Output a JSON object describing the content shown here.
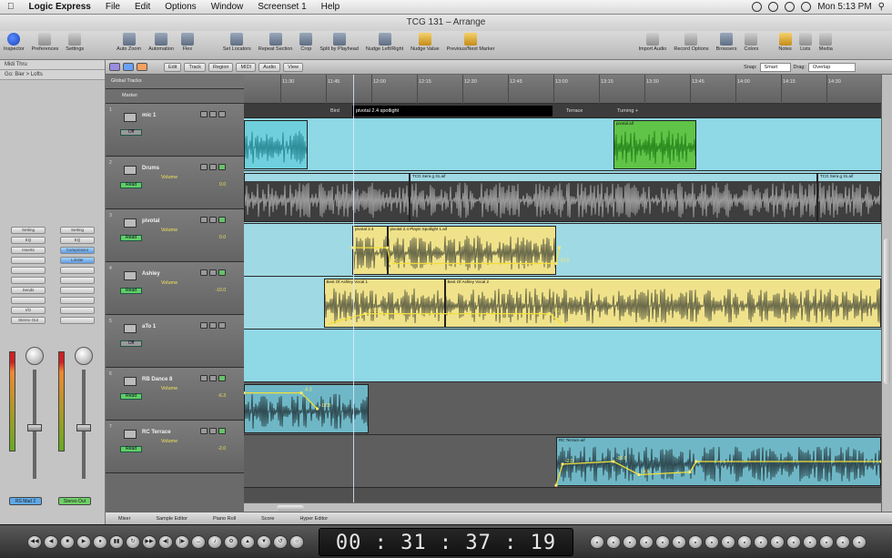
{
  "menubar": {
    "app": "Logic Express",
    "items": [
      "File",
      "Edit",
      "Options",
      "Window",
      "Screenset 1",
      "Help"
    ],
    "clock": "Mon 5:13 PM"
  },
  "window": {
    "title": "TCG 131 – Arrange"
  },
  "toolbar": {
    "items": [
      {
        "label": "Inspector",
        "icon": "info-icon",
        "style": "b"
      },
      {
        "label": "Preferences",
        "icon": "preferences-icon",
        "style": "g"
      },
      {
        "label": "Settings",
        "icon": "settings-icon",
        "style": "g"
      },
      {
        "label": "Auto Zoom",
        "icon": "zoom-icon",
        "style": ""
      },
      {
        "label": "Automation",
        "icon": "automation-icon",
        "style": ""
      },
      {
        "label": "Flex",
        "icon": "flex-icon",
        "style": ""
      },
      {
        "label": "Set Locators",
        "icon": "locators-icon",
        "style": ""
      },
      {
        "label": "Repeat Section",
        "icon": "repeat-icon",
        "style": ""
      },
      {
        "label": "Crop",
        "icon": "crop-icon",
        "style": ""
      },
      {
        "label": "Split by Playhead",
        "icon": "split-icon",
        "style": ""
      },
      {
        "label": "Nudge Left/Right",
        "icon": "nudge-icon",
        "style": ""
      },
      {
        "label": "Nudge Value",
        "icon": "nudge-value-icon",
        "style": "y"
      },
      {
        "label": "Previous/Next Marker",
        "icon": "marker-icon",
        "style": "y"
      },
      {
        "label": "Import Audio",
        "icon": "microphone-icon",
        "style": "g"
      },
      {
        "label": "Record Options",
        "icon": "record-options-icon",
        "style": "g"
      },
      {
        "label": "Browsers",
        "icon": "browsers-icon",
        "style": ""
      },
      {
        "label": "Colors",
        "icon": "colors-icon",
        "style": "g"
      },
      {
        "label": "Notes",
        "icon": "notes-icon",
        "style": "y"
      },
      {
        "label": "Lists",
        "icon": "lists-icon",
        "style": "g"
      },
      {
        "label": "Media",
        "icon": "media-icon",
        "style": "g"
      }
    ]
  },
  "inspector": {
    "sections": [
      "Midi Thru",
      "Go: Bier > Lofts"
    ],
    "strip1": {
      "buttons": [
        "Setting",
        "EQ",
        "Inserts",
        "",
        "",
        "",
        "Sends",
        "",
        "I/O",
        "Stereo Out"
      ],
      "name": "RS Mad 2",
      "name_color": "#5fa8e6"
    },
    "strip2": {
      "buttons": [
        "Setting",
        "EQ",
        "Compressor",
        "Limiter",
        "",
        "",
        "",
        "",
        "",
        ""
      ],
      "name": "Stereo Out",
      "name_color": "#6fd067"
    }
  },
  "localbar": {
    "menus": [
      "Edit",
      "Track",
      "Region",
      "MIDI",
      "Audio",
      "View"
    ],
    "snap_label": "Snap:",
    "snap_value": "Smart",
    "drag_label": "Drag:",
    "drag_value": "Overlap"
  },
  "ruler": {
    "ticks": [
      "11:30",
      "11:45",
      "12:00",
      "12:15",
      "12:30",
      "12:45",
      "13:00",
      "13:15",
      "13:30",
      "13:45",
      "14:00",
      "14:15",
      "14:30"
    ]
  },
  "global_tracks": {
    "label": "Global Tracks",
    "marker_label": "Marker"
  },
  "markers": [
    {
      "label": "Bird",
      "pos": 0.13
    },
    {
      "label": "pivotal 2.4 spotlight",
      "pos": 0.17,
      "selected": true
    },
    {
      "label": "Terrace",
      "pos": 0.5
    },
    {
      "label": "Turning +",
      "pos": 0.58
    }
  ],
  "tracks": [
    {
      "num": "1",
      "name": "mic 1",
      "vol_label": "",
      "readout": "Off",
      "value": "",
      "green": false,
      "bg": "#8fd8e6"
    },
    {
      "num": "2",
      "name": "Drums",
      "vol_label": "Volume",
      "readout": "Read",
      "value": "0.0",
      "green": true,
      "bg": "#9fd9e4"
    },
    {
      "num": "3",
      "name": "pivotal",
      "vol_label": "Volume",
      "readout": "Read",
      "value": "0.0",
      "green": true,
      "bg": "#9fd9e4"
    },
    {
      "num": "4",
      "name": "Ashley",
      "vol_label": "Volume",
      "readout": "Read",
      "value": "-10.0",
      "green": true,
      "bg": "#9fd9e4"
    },
    {
      "num": "5",
      "name": "aTo 1",
      "vol_label": "",
      "readout": "Off",
      "value": "",
      "green": false,
      "bg": "#8fd8e6"
    },
    {
      "num": "6",
      "name": "RB Dance 8",
      "vol_label": "Volume",
      "readout": "Read",
      "value": "-6.3",
      "green": true,
      "bg": "#5e5e5e"
    },
    {
      "num": "7",
      "name": "RC Terrace",
      "vol_label": "Volume",
      "readout": "Read",
      "value": "-2.0",
      "green": true,
      "bg": "#5e5e5e"
    }
  ],
  "regions": [
    {
      "track": 0,
      "start": 0.0,
      "end": 0.1,
      "color": "#6fcfdc",
      "name": "",
      "wave": "#2d8e9a"
    },
    {
      "track": 0,
      "start": 0.58,
      "end": 0.71,
      "color": "#5fc447",
      "name": "pivotal.aif",
      "wave": "#2b8a1f"
    },
    {
      "track": 1,
      "start": 0.0,
      "end": 0.26,
      "color": "#3e3e3e",
      "name": "",
      "wave": "#9a9a9a"
    },
    {
      "track": 1,
      "start": 0.26,
      "end": 0.9,
      "color": "#3e3e3e",
      "name": "TCG Sera g 31.aif",
      "wave": "#9a9a9a"
    },
    {
      "track": 1,
      "start": 0.9,
      "end": 1.0,
      "color": "#3e3e3e",
      "name": "TCG Sera g 31.aif",
      "wave": "#9a9a9a"
    },
    {
      "track": 2,
      "start": 0.17,
      "end": 0.225,
      "color": "#f0e28a",
      "name": "pivotal 2.4",
      "wave": "#6a6a4a"
    },
    {
      "track": 2,
      "start": 0.225,
      "end": 0.49,
      "color": "#f0e28a",
      "name": "pivotal 2.4 Playin Spotlight 1.aif",
      "wave": "#6a6a4a"
    },
    {
      "track": 3,
      "start": 0.125,
      "end": 0.315,
      "color": "#f0e28a",
      "name": "Best Of Ashley Vocal 1",
      "wave": "#6a6a4a"
    },
    {
      "track": 3,
      "start": 0.315,
      "end": 1.0,
      "color": "#f0e28a",
      "name": "Best Of Ashley Vocal 2",
      "wave": "#6a6a4a"
    },
    {
      "track": 5,
      "start": 0.0,
      "end": 0.195,
      "color": "#6fb7c6",
      "name": "",
      "wave": "#304b52"
    },
    {
      "track": 6,
      "start": 0.49,
      "end": 1.0,
      "color": "#6fb7c6",
      "name": "RC Terrace.aif",
      "wave": "#304b52"
    }
  ],
  "automation": [
    {
      "track": 2,
      "points": [
        [
          0.17,
          0.45
        ],
        [
          0.225,
          0.45
        ],
        [
          0.23,
          0.75
        ],
        [
          0.49,
          0.75
        ],
        [
          0.495,
          0.45
        ]
      ],
      "labels": [
        "0.0",
        "+0.0",
        "-20.0"
      ]
    },
    {
      "track": 3,
      "points": [
        [
          0.13,
          0.9
        ],
        [
          0.19,
          0.7
        ],
        [
          0.48,
          0.7
        ],
        [
          0.5,
          0.9
        ]
      ],
      "labels": [
        "-10.0",
        "-6.2"
      ]
    },
    {
      "track": 5,
      "points": [
        [
          0.0,
          0.2
        ],
        [
          0.09,
          0.2
        ],
        [
          0.115,
          0.5
        ]
      ],
      "labels": [
        "-6.3",
        "-18.8"
      ]
    },
    {
      "track": 6,
      "points": [
        [
          0.49,
          0.95
        ],
        [
          0.5,
          0.55
        ],
        [
          0.58,
          0.5
        ],
        [
          0.62,
          0.75
        ],
        [
          0.7,
          0.7
        ],
        [
          0.71,
          0.5
        ],
        [
          1.0,
          0.5
        ]
      ],
      "labels": [
        "-2.0",
        "-10.0",
        "-6.8"
      ]
    }
  ],
  "bottom_tabs": [
    "Mixer",
    "Sample Editor",
    "Piano Roll",
    "Score",
    "Hyper Editor"
  ],
  "transport": {
    "time": "00 : 31 : 37 : 19"
  }
}
